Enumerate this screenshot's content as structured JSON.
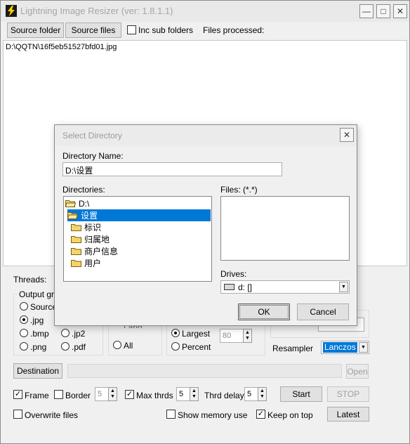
{
  "app": {
    "title": "Lightning Image Resizer (ver: 1.8.1.1)",
    "window_controls": {
      "minimize": "—",
      "maximize": "□",
      "close": "✕"
    }
  },
  "toolbar": {
    "source_folder": "Source folder",
    "source_files": "Source files",
    "inc_sub_folders": "Inc sub folders",
    "files_processed": "Files processed:"
  },
  "file_list": [
    "D:\\QQTN\\16f5eb51527bfd01.jpg"
  ],
  "settings": {
    "threads_label": "Threads:",
    "output_group": "Output gra",
    "formats": [
      {
        "label": "Source",
        "checked": false
      },
      {
        "label": ".jpg",
        "checked": true
      },
      {
        "label": ".bmp",
        "checked": false
      },
      {
        "label": ".jp2",
        "checked": false
      },
      {
        "label": ".png",
        "checked": false
      },
      {
        "label": ".pdf",
        "checked": false
      }
    ],
    "partial_radio": "Land",
    "all_radio": "All",
    "largest": "Largest",
    "percent": "Percent",
    "quality_value": "80",
    "resampler_label": "Resampler",
    "resampler_value": "Lanczos"
  },
  "bottom": {
    "destination": "Destination",
    "open": "Open",
    "frame": "Frame",
    "border": "Border",
    "border_value": "5",
    "max_thrds": "Max thrds",
    "max_thrds_value": "5",
    "thrd_delay": "Thrd delay",
    "thrd_delay_value": "5",
    "start": "Start",
    "stop": "STOP",
    "overwrite_files": "Overwrite files",
    "show_memory_use": "Show memory use",
    "keep_on_top": "Keep on top",
    "latest": "Latest"
  },
  "dialog": {
    "title": "Select Directory",
    "dir_name_label": "Directory Name:",
    "dir_name_value": "D:\\设置",
    "directories_label": "Directories:",
    "directories": [
      {
        "name": "D:\\",
        "level": 0,
        "open": true,
        "selected": false
      },
      {
        "name": "设置",
        "level": 1,
        "open": true,
        "selected": true
      },
      {
        "name": "标识",
        "level": 2,
        "open": false,
        "selected": false
      },
      {
        "name": "归属地",
        "level": 2,
        "open": false,
        "selected": false
      },
      {
        "name": "商户信息",
        "level": 2,
        "open": false,
        "selected": false
      },
      {
        "name": "用户",
        "level": 2,
        "open": false,
        "selected": false
      }
    ],
    "files_label": "Files: (*.*)",
    "drives_label": "Drives:",
    "drive_value": "d: []",
    "ok": "OK",
    "cancel": "Cancel"
  },
  "colors": {
    "selection": "#0078d7",
    "title_text_inactive": "#a6a6a6",
    "folder_yellow": "#f5d56a"
  }
}
